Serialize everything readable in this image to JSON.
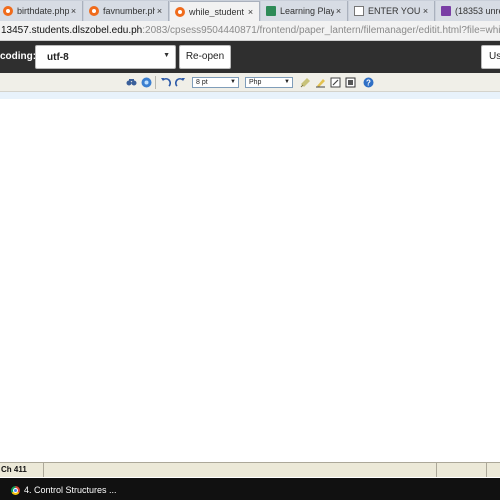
{
  "tabs": [
    {
      "title": "birthdate.php",
      "favicon": "cpanel-icon",
      "active": false
    },
    {
      "title": "favnumber.php",
      "favicon": "cpanel-icon",
      "active": false
    },
    {
      "title": "while_student",
      "favicon": "cpanel-icon",
      "active": true
    },
    {
      "title": "Learning Play",
      "favicon": "classroom-icon",
      "active": false
    },
    {
      "title": "ENTER YOUR",
      "favicon": "document-icon",
      "active": false
    },
    {
      "title": "(18353 unre",
      "favicon": "mail-icon",
      "active": false
    }
  ],
  "tab_close_glyph": "×",
  "address": {
    "host": "13457.students.dlszobel.edu.ph",
    "path": ":2083/cpsess9504440871/frontend/paper_lantern/filemanager/editit.html?file=while_students"
  },
  "header": {
    "encoding_label": "coding:",
    "encoding_value": "utf-8",
    "reopen_label": "Re-open",
    "right_button_label": "Us"
  },
  "toolbar": {
    "font_size_value": "8 pt",
    "syntax_value": "Php",
    "icons": [
      "search-replace-icon",
      "goto-icon",
      "undo-icon",
      "redo-icon",
      "highlight-icon",
      "eraser-icon",
      "toggle-editor-icon",
      "fullscreen-icon",
      "help-icon"
    ]
  },
  "status": {
    "position": "Ch 411"
  },
  "taskbar": {
    "item_label": "4. Control Structures ..."
  },
  "colors": {
    "header_bg": "#2f2f2f",
    "toolbar_bg": "#f0efe8",
    "status_bg": "#ece9d8",
    "taskbar_bg": "#111111",
    "current_line": "#e8f2fb"
  }
}
